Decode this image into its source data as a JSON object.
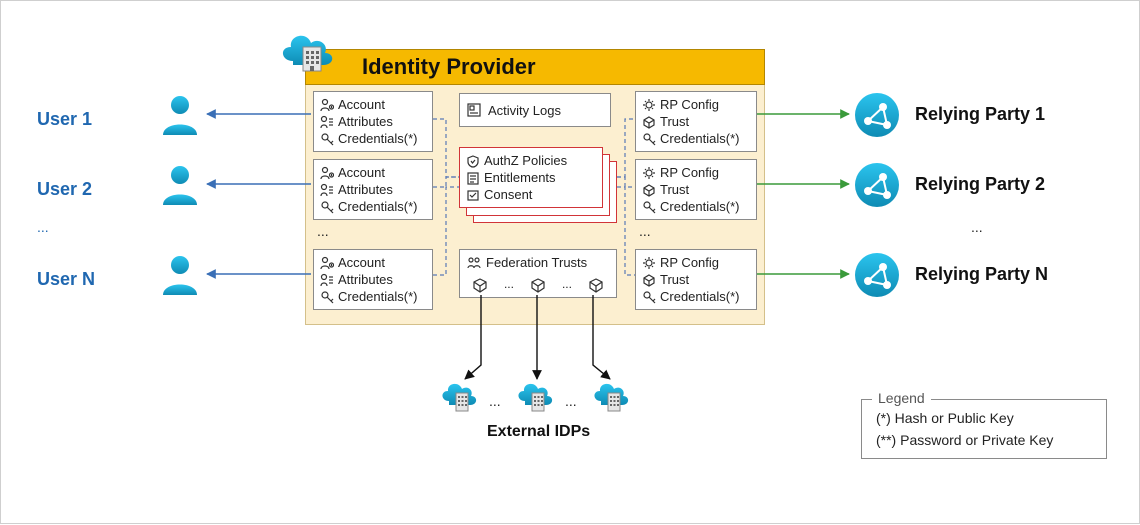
{
  "title": "Identity Provider",
  "users": {
    "label_prefix": "User",
    "items": [
      {
        "label": "User 1"
      },
      {
        "label": "User 2"
      },
      {
        "label": "User N"
      }
    ],
    "ellipsis": "..."
  },
  "relying_parties": {
    "items": [
      {
        "label": "Relying Party 1"
      },
      {
        "label": "Relying Party 2"
      },
      {
        "label": "Relying Party N"
      }
    ],
    "ellipsis": "..."
  },
  "account_box": {
    "rows": [
      "Account",
      "Attributes",
      "Credentials(*)"
    ],
    "ellipsis": "..."
  },
  "rp_box": {
    "rows": [
      "RP Config",
      "Trust",
      "Credentials(*)"
    ],
    "ellipsis": "..."
  },
  "activity_logs": {
    "label": "Activity Logs"
  },
  "authz_box": {
    "rows": [
      "AuthZ Policies",
      "Entitlements",
      "Consent"
    ]
  },
  "federation_box": {
    "label": "Federation Trusts",
    "ellipsis": "..."
  },
  "external_idps": {
    "label": "External IDPs",
    "ellipsis": "..."
  },
  "legend": {
    "title": "Legend",
    "line1": "(*) Hash or Public Key",
    "line2": "(**) Password or Private Key"
  },
  "colors": {
    "accent_blue": "#13B1E0",
    "accent_blue_dark": "#0E8BB4",
    "arrow_blue": "#3A6FB6",
    "arrow_green": "#3A9A3A",
    "arrow_black": "#111111",
    "dashed": "#5A79B6",
    "red": "#D13438",
    "gold": "#F6B900"
  }
}
